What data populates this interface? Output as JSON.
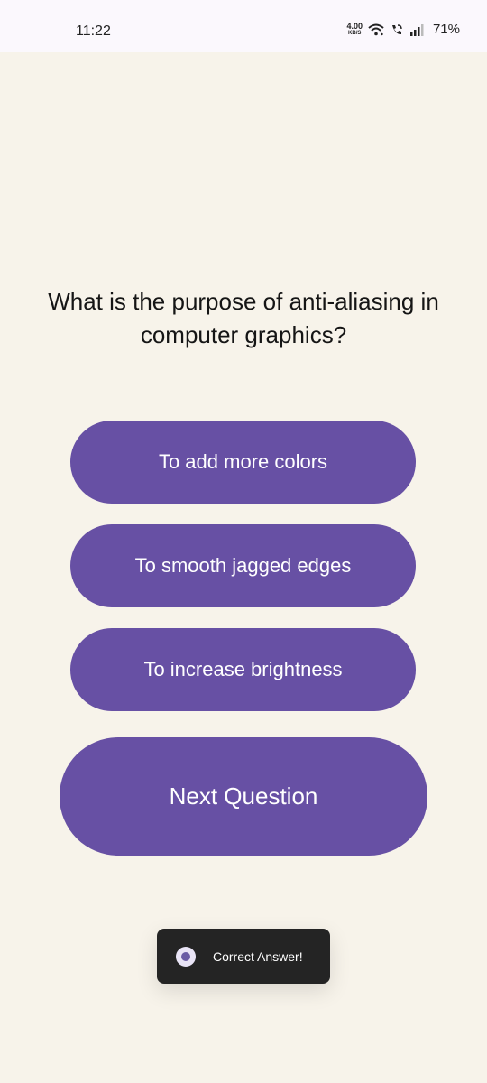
{
  "status_bar": {
    "time": "11:22",
    "net_speed_value": "4.00",
    "net_speed_unit": "KB/S",
    "battery": "71%",
    "icons": [
      "wifi-icon",
      "call-icon",
      "signal-icon"
    ]
  },
  "quiz": {
    "question": "What is the purpose of anti-aliasing in computer graphics?",
    "options": [
      {
        "label": "To add more colors"
      },
      {
        "label": "To smooth jagged edges"
      },
      {
        "label": "To increase brightness"
      }
    ],
    "next_label": "Next Question"
  },
  "toast": {
    "text": "Correct Answer!",
    "icon": "app-icon"
  },
  "colors": {
    "accent": "#6750a4",
    "background": "#f7f3ea",
    "toast_background": "#242424"
  }
}
